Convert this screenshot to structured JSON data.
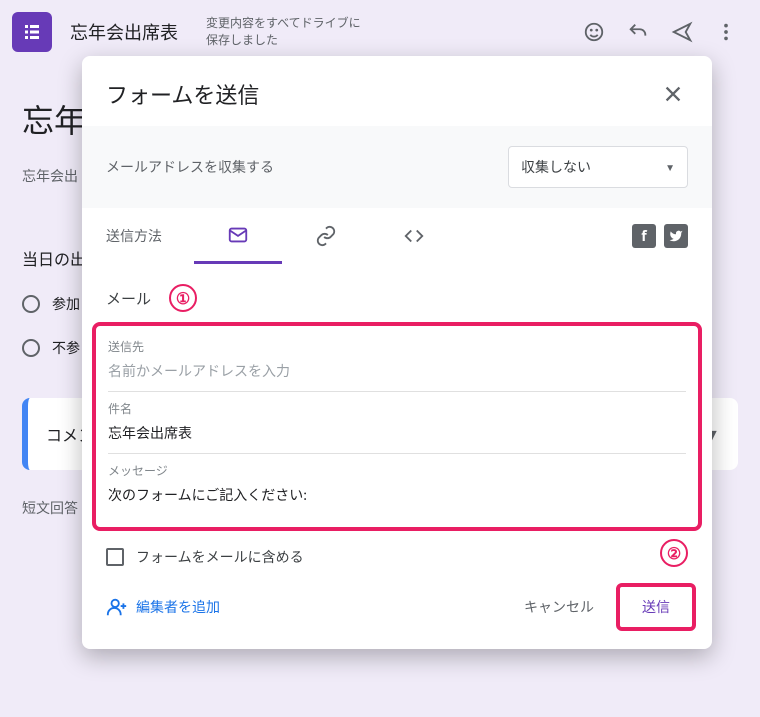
{
  "header": {
    "form_title": "忘年会出席表",
    "save_status_line1": "変更内容をすべてドライブに",
    "save_status_line2": "保存しました"
  },
  "background": {
    "title": "忘年",
    "description": "忘年会出",
    "question": "当日の出",
    "option1": "参加",
    "option2": "不参",
    "card_text": "コメン",
    "short_answer": "短文回答"
  },
  "dialog": {
    "title": "フォームを送信",
    "collect_label": "メールアドレスを収集する",
    "collect_value": "収集しない",
    "tabs_label": "送信方法",
    "mail_heading": "メール",
    "to_label": "送信先",
    "to_placeholder": "名前かメールアドレスを入力",
    "subject_label": "件名",
    "subject_value": "忘年会出席表",
    "message_label": "メッセージ",
    "message_value": "次のフォームにご記入ください:",
    "include_label": "フォームをメールに含める",
    "add_editor": "編集者を追加",
    "cancel": "キャンセル",
    "send": "送信"
  },
  "annotations": {
    "one": "①",
    "two": "②"
  }
}
